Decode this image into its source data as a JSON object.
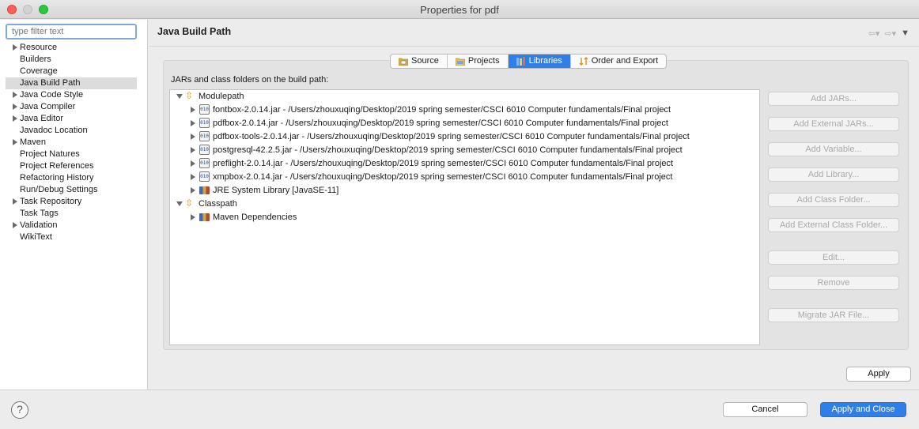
{
  "window": {
    "title": "Properties for pdf"
  },
  "filter": {
    "placeholder": "type filter text"
  },
  "sidebar": {
    "items": [
      {
        "label": "Resource",
        "expandable": true
      },
      {
        "label": "Builders",
        "expandable": false
      },
      {
        "label": "Coverage",
        "expandable": false
      },
      {
        "label": "Java Build Path",
        "expandable": false,
        "selected": true
      },
      {
        "label": "Java Code Style",
        "expandable": true
      },
      {
        "label": "Java Compiler",
        "expandable": true
      },
      {
        "label": "Java Editor",
        "expandable": true
      },
      {
        "label": "Javadoc Location",
        "expandable": false
      },
      {
        "label": "Maven",
        "expandable": true
      },
      {
        "label": "Project Natures",
        "expandable": false
      },
      {
        "label": "Project References",
        "expandable": false
      },
      {
        "label": "Refactoring History",
        "expandable": false
      },
      {
        "label": "Run/Debug Settings",
        "expandable": false
      },
      {
        "label": "Task Repository",
        "expandable": true
      },
      {
        "label": "Task Tags",
        "expandable": false
      },
      {
        "label": "Validation",
        "expandable": true
      },
      {
        "label": "WikiText",
        "expandable": false
      }
    ]
  },
  "page": {
    "title": "Java Build Path"
  },
  "tabs": [
    {
      "label": "Source",
      "active": false
    },
    {
      "label": "Projects",
      "active": false
    },
    {
      "label": "Libraries",
      "active": true
    },
    {
      "label": "Order and Export",
      "active": false
    }
  ],
  "build_path_label": "JARs and class folders on the build path:",
  "tree": {
    "modulepath": {
      "label": "Modulepath",
      "children": [
        "fontbox-2.0.14.jar - /Users/zhouxuqing/Desktop/2019 spring semester/CSCI 6010 Computer fundamentals/Final project",
        "pdfbox-2.0.14.jar - /Users/zhouxuqing/Desktop/2019 spring semester/CSCI 6010 Computer fundamentals/Final project",
        "pdfbox-tools-2.0.14.jar - /Users/zhouxuqing/Desktop/2019 spring semester/CSCI 6010 Computer fundamentals/Final project",
        "postgresql-42.2.5.jar - /Users/zhouxuqing/Desktop/2019 spring semester/CSCI 6010 Computer fundamentals/Final project",
        "preflight-2.0.14.jar - /Users/zhouxuqing/Desktop/2019 spring semester/CSCI 6010 Computer fundamentals/Final project",
        "xmpbox-2.0.14.jar - /Users/zhouxuqing/Desktop/2019 spring semester/CSCI 6010 Computer fundamentals/Final project",
        "JRE System Library [JavaSE-11]"
      ]
    },
    "classpath": {
      "label": "Classpath",
      "children": [
        "Maven Dependencies"
      ]
    }
  },
  "side_buttons": [
    "Add JARs...",
    "Add External JARs...",
    "Add Variable...",
    "Add Library...",
    "Add Class Folder...",
    "Add External Class Folder...",
    "Edit...",
    "Remove",
    "Migrate JAR File..."
  ],
  "buttons": {
    "apply": "Apply",
    "cancel": "Cancel",
    "apply_close": "Apply and Close"
  },
  "help": "?"
}
